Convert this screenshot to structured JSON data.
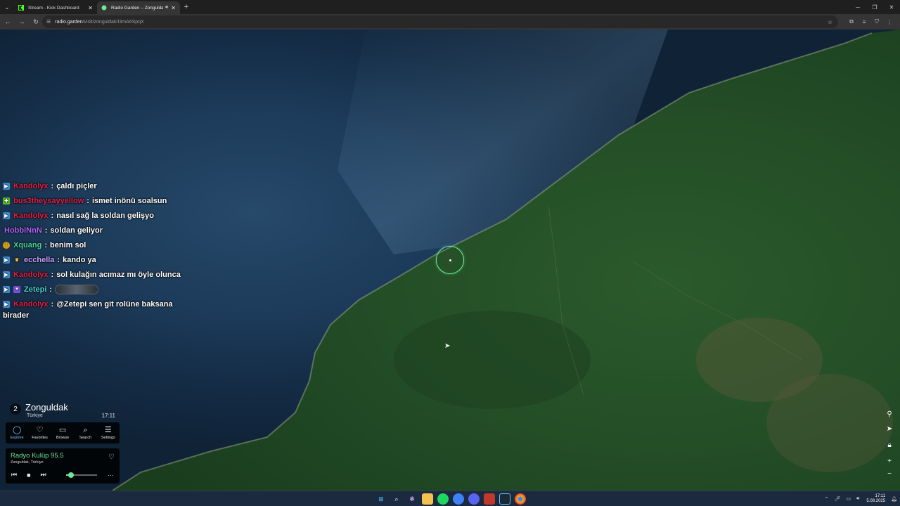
{
  "browser": {
    "tabs": [
      {
        "title": "Stream - Kick Dashboard",
        "active": false,
        "favicon": "kick-icon"
      },
      {
        "title": "Radio Garden – Zonguldak",
        "active": true,
        "favicon": "radio-garden-icon"
      }
    ],
    "url_host": "radio.garden",
    "url_path": "/visit/zonguldak/I3mA6SpqX"
  },
  "chat": [
    {
      "badge_color": "#3f8fd6",
      "badge": "▶",
      "user": "Kandolyx",
      "user_color": "#e0204a",
      "message": "çaldı piçler"
    },
    {
      "badge_color": "#53c41a",
      "badge": "✚",
      "user": "bus3theysayyellow",
      "user_color": "#e0204a",
      "message": "ismet inönü soalsun"
    },
    {
      "badge_color": "#3f8fd6",
      "badge": "▶",
      "user": "Kandolyx",
      "user_color": "#e0204a",
      "message": "nasıl sağ la soldan gelişyo"
    },
    {
      "badge_color": "",
      "badge": "",
      "user": "HobbiNnN",
      "user_color": "#b266ff",
      "message": "soldan geliyor"
    },
    {
      "badge_color": "#e0a000",
      "badge": "!",
      "user": "Xquang",
      "user_color": "#46d69a",
      "message": "benim sol"
    },
    {
      "badge_color": "#2f3b4c",
      "badge": "♛",
      "user": "ecchella",
      "user_color": "#c8a0ff",
      "message": "kando ya"
    },
    {
      "badge_color": "#3f8fd6",
      "badge": "▶",
      "user": "Kandolyx",
      "user_color": "#e0204a",
      "message": "sol kulağın acımaz mı öyle olunca"
    },
    {
      "badge_color": "#7a4fe0",
      "badge": "♥",
      "user": "Zetepi",
      "user_color": "#46d6d6",
      "message": ""
    },
    {
      "badge_color": "#3f8fd6",
      "badge": "▶",
      "user": "Kandolyx",
      "user_color": "#e0204a",
      "message": "@Zetepi sen git rolüne baksana"
    }
  ],
  "chat_wrap_line": "birader",
  "radio": {
    "count": "2",
    "city": "Zonguldak",
    "country": "Türkiye",
    "time": "17:11",
    "nav": [
      {
        "label": "Explore",
        "icon": "explore-icon",
        "glyph": "◯"
      },
      {
        "label": "Favorites",
        "icon": "heart-icon",
        "glyph": "♡"
      },
      {
        "label": "Browse",
        "icon": "map-icon",
        "glyph": "▭"
      },
      {
        "label": "Search",
        "icon": "search-icon",
        "glyph": "⌕"
      },
      {
        "label": "Settings",
        "icon": "menu-icon",
        "glyph": "☰"
      }
    ],
    "station": "Radyo Kulüp 95.5",
    "station_sub": "Zonguldak, Türkiye",
    "volume": 0.15
  },
  "taskbar": {
    "time": "17:11",
    "date": "5.08.2025"
  },
  "colors": {
    "accent": "#6ee79a",
    "active_tab_nav": "#7ec8ff"
  }
}
